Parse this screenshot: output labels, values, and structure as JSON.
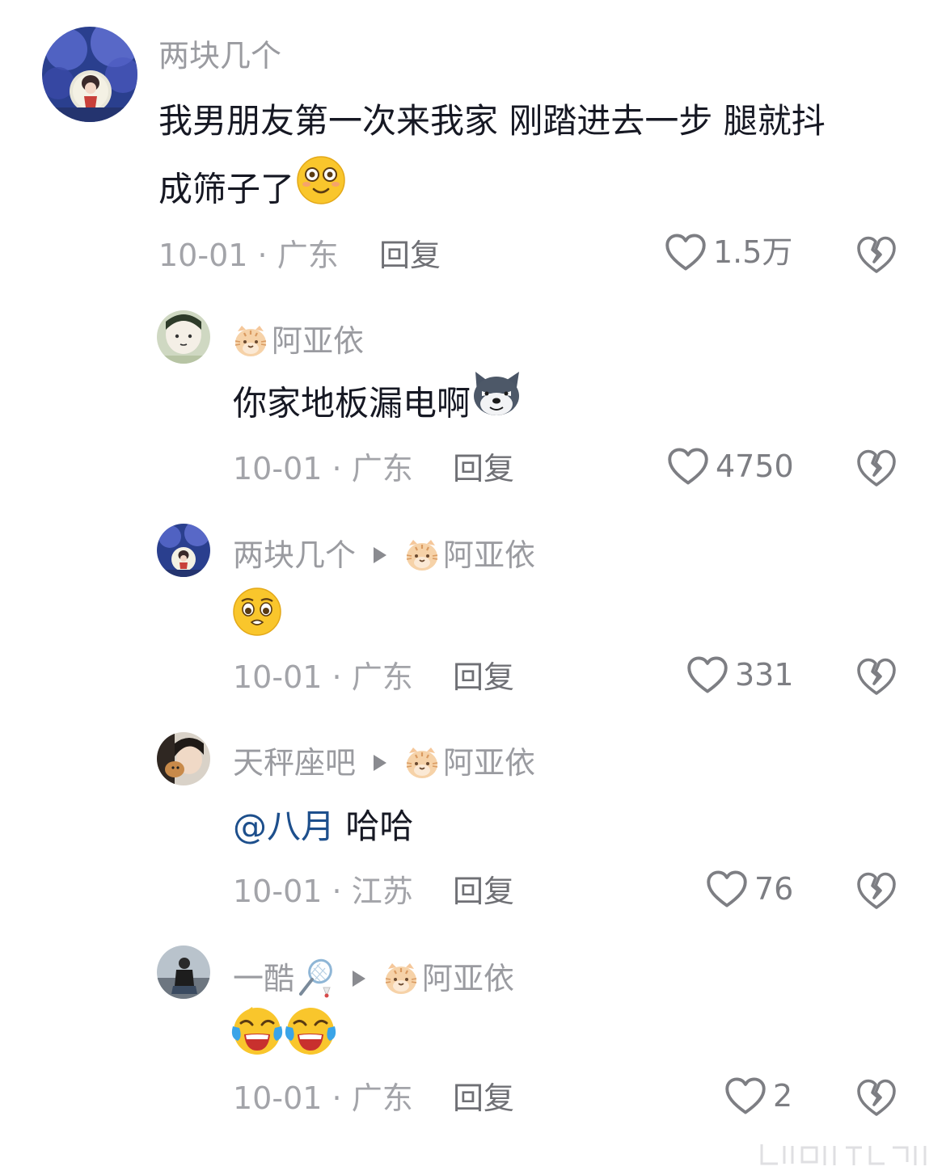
{
  "comments": [
    {
      "author": "两块几个",
      "text_line1": "我男朋友第一次来我家 刚踏进去一步 腿就抖",
      "text_line2": "成筛子了",
      "date": "10-01",
      "separator": "·",
      "location": "广东",
      "reply_label": "回复",
      "likes": "1.5万"
    },
    {
      "author": "阿亚依",
      "text": "你家地板漏电啊",
      "date": "10-01",
      "separator": "·",
      "location": "广东",
      "reply_label": "回复",
      "likes": "4750"
    },
    {
      "author": "两块几个",
      "reply_to": "阿亚依",
      "date": "10-01",
      "separator": "·",
      "location": "广东",
      "reply_label": "回复",
      "likes": "331"
    },
    {
      "author": "天秤座吧",
      "reply_to": "阿亚依",
      "mention": "@八月",
      "text": " 哈哈",
      "date": "10-01",
      "separator": "·",
      "location": "江苏",
      "reply_label": "回复",
      "likes": "76"
    },
    {
      "author": "一酷",
      "reply_to": "阿亚依",
      "date": "10-01",
      "separator": "·",
      "location": "广东",
      "reply_label": "回复",
      "likes": "2"
    }
  ],
  "icons": {
    "like": "heart-outline-icon",
    "dislike": "broken-heart-icon",
    "reply_arrow": "play-triangle-icon",
    "badge": "tiger-face-icon"
  },
  "colors": {
    "name": "#9a9ba0",
    "text": "#161823",
    "meta": "#a3a4a9",
    "mention": "#1d4f8c",
    "emoji_yellow": "#f9c62c"
  }
}
